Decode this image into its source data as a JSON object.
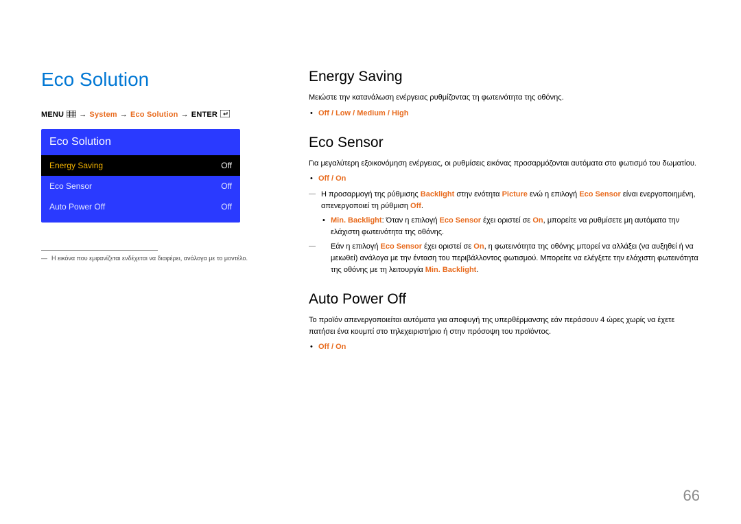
{
  "page_number": "66",
  "title": "Eco Solution",
  "breadcrumb": {
    "menu": "MENU",
    "system": "System",
    "eco": "Eco Solution",
    "enter": "ENTER"
  },
  "osd": {
    "header": "Eco Solution",
    "rows": [
      {
        "label": "Energy Saving",
        "value": "Off",
        "selected": true
      },
      {
        "label": "Eco Sensor",
        "value": "Off",
        "selected": false
      },
      {
        "label": "Auto Power Off",
        "value": "Off",
        "selected": false
      }
    ]
  },
  "footnote": "Η εικόνα που εμφανίζεται ενδέχεται να διαφέρει, ανάλογα με το μοντέλο.",
  "sections": {
    "energy": {
      "heading": "Energy Saving",
      "desc": "Μειώστε την κατανάλωση ενέργειας ρυθμίζοντας τη φωτεινότητα της οθόνης.",
      "opts": [
        "Off",
        "Low",
        "Medium",
        "High"
      ]
    },
    "eco": {
      "heading": "Eco Sensor",
      "desc": "Για μεγαλύτερη εξοικονόμηση ενέργειας, οι ρυθμίσεις εικόνας προσαρμόζονται αυτόματα στο φωτισμό του δωματίου.",
      "opts": [
        "Off",
        "On"
      ],
      "note1_a": "Η προσαρμογή της ρύθμισης ",
      "note1_b": "Backlight",
      "note1_c": " στην ενότητα ",
      "note1_d": "Picture",
      "note1_e": " ενώ η επιλογή ",
      "note1_f": "Eco Sensor",
      "note1_g": " είναι ενεργοποιημένη, απενεργοποιεί τη ρύθμιση ",
      "note1_h": "Off",
      "note1_i": ".",
      "sub_a": "Min. Backlight",
      "sub_b": ": Όταν η επιλογή ",
      "sub_c": "Eco Sensor",
      "sub_d": " έχει οριστεί σε ",
      "sub_e": "On",
      "sub_f": ", μπορείτε να ρυθμίσετε μη αυτόματα την ελάχιστη φωτεινότητα της οθόνης.",
      "note2_a": "Εάν η επιλογή ",
      "note2_b": "Eco Sensor",
      "note2_c": " έχει οριστεί σε ",
      "note2_d": "On",
      "note2_e": ", η φωτεινότητα της οθόνης μπορεί να αλλάξει (να αυξηθεί ή να μειωθεί) ανάλογα με την ένταση του περιβάλλοντος φωτισμού. Μπορείτε να ελέγξετε την ελάχιστη φωτεινότητα της οθόνης με τη λειτουργία ",
      "note2_f": "Min. Backlight",
      "note2_g": "."
    },
    "auto": {
      "heading": "Auto Power Off",
      "desc": "Το προϊόν απενεργοποιείται αυτόματα για αποφυγή της υπερθέρμανσης εάν περάσουν 4 ώρες χωρίς να έχετε πατήσει ένα κουμπί στο τηλεχειριστήριο ή στην πρόσοψη του προϊόντος.",
      "opts": [
        "Off",
        "On"
      ]
    }
  }
}
